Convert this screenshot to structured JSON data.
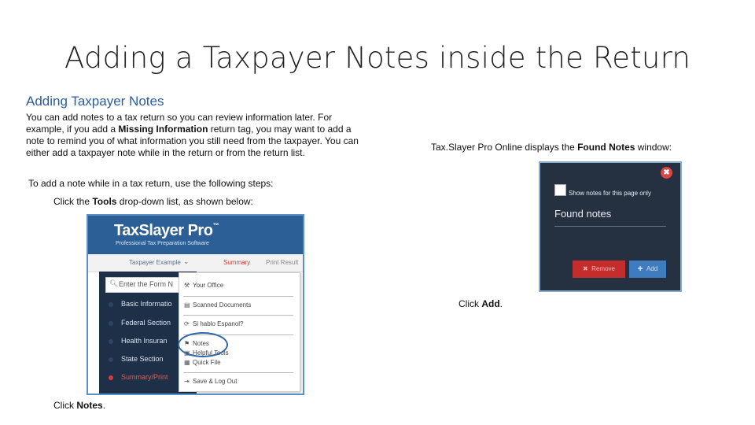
{
  "slide": {
    "title": "Adding a Taxpayer Notes inside the Return"
  },
  "left": {
    "heading": "Adding Taxpayer Notes",
    "para": {
      "p1": "You can add notes to a tax return so you can review information later. For example, if you add a ",
      "p1_bold": "Missing Information",
      "p2": " return tag, you may want to add a note to remind you of what information you still need from the taxpayer. You can either add a taxpayer note while in the return or from the return list."
    },
    "step1": "To add a note while in a tax return, use the following steps:",
    "step2": {
      "pre": "Click the ",
      "bold": "Tools",
      "post": " drop-down list, as shown below:"
    },
    "caption": {
      "pre": "Click ",
      "bold": "Notes",
      "post": "."
    }
  },
  "screenshot1": {
    "logo": "TaxSlayer Pro",
    "logo_tm": "™",
    "subtitle": "Professional Tax Preparation Software",
    "nav": {
      "taxpayer": "Taxpayer Example",
      "summary": "Summary",
      "print": "Print Result"
    },
    "search_placeholder": "Enter the Form N",
    "sidebar": [
      {
        "label": "Basic Informatio"
      },
      {
        "label": "Federal Section"
      },
      {
        "label": "Health Insuran"
      },
      {
        "label": "State Section"
      },
      {
        "label": "Summary/Print"
      }
    ],
    "dropdown": [
      {
        "icon": "wrench-icon",
        "glyph": "⚒",
        "label": "Your Office"
      },
      {
        "icon": "document-icon",
        "glyph": "▤",
        "label": "Scanned Documents"
      },
      {
        "icon": "refresh-icon",
        "glyph": "⟳",
        "label": "Si hablo Espanol?"
      },
      {
        "icon": "flag-icon",
        "glyph": "⚑",
        "label": "Notes"
      },
      {
        "icon": "briefcase-icon",
        "glyph": "▣",
        "label": "Helpful Tools"
      },
      {
        "icon": "file-icon",
        "glyph": "▦",
        "label": "Quick File"
      },
      {
        "icon": "logout-icon",
        "glyph": "⇥",
        "label": "Save & Log Out"
      }
    ]
  },
  "right": {
    "caption_top": {
      "pre": "Tax.Slayer Pro Online displays the ",
      "bold": "Found Notes",
      "post": " window:"
    },
    "caption_bottom": {
      "pre": "Click ",
      "bold": "Add",
      "post": "."
    }
  },
  "screenshot2": {
    "checkbox_label": "Show notes for this page only",
    "title": "Found notes",
    "remove_label": "Remove",
    "add_label": "Add",
    "close_glyph": "✖",
    "remove_glyph": "✖",
    "add_glyph": "✚"
  }
}
